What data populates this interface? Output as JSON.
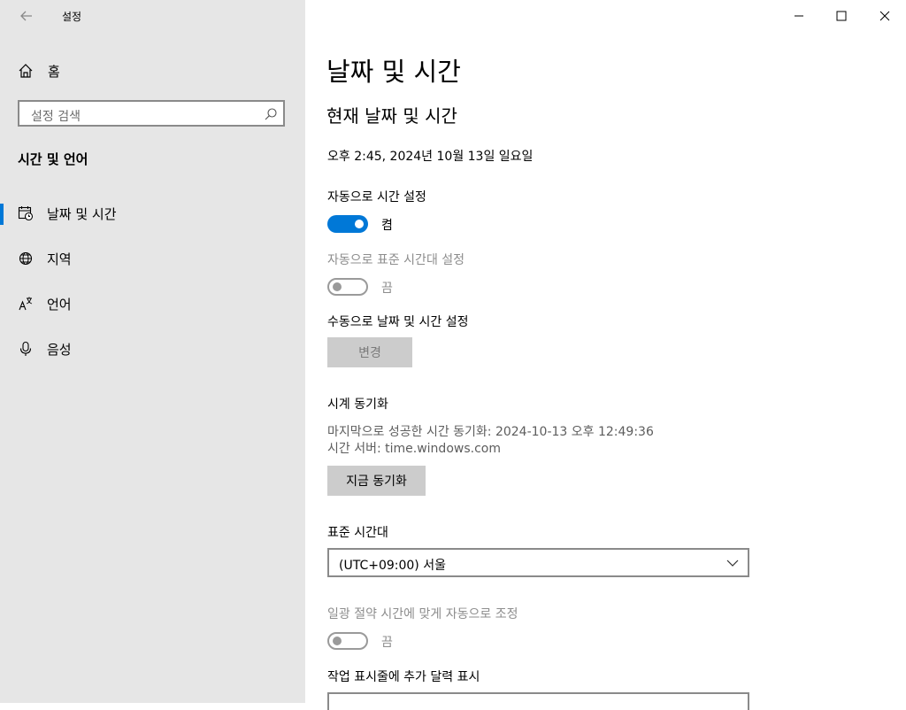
{
  "window": {
    "app_title": "설정",
    "controls": [
      "minimize-icon",
      "maximize-icon",
      "close-icon"
    ]
  },
  "sidebar": {
    "home_label": "홈",
    "search_placeholder": "설정 검색",
    "section_title": "시간 및 언어",
    "items": [
      {
        "label": "날짜 및 시간",
        "icon": "calendar-clock-icon",
        "selected": true
      },
      {
        "label": "지역",
        "icon": "globe-icon",
        "selected": false
      },
      {
        "label": "언어",
        "icon": "language-icon",
        "selected": false
      },
      {
        "label": "음성",
        "icon": "microphone-icon",
        "selected": false
      }
    ]
  },
  "main": {
    "page_title": "날짜 및 시간",
    "current_heading": "현재 날짜 및 시간",
    "current_datetime": "오후 2:45, 2024년 10월 13일 일요일",
    "auto_time": {
      "label": "자동으로 시간 설정",
      "state": "켬",
      "on": true
    },
    "auto_timezone": {
      "label": "자동으로 표준 시간대 설정",
      "state": "끔",
      "on": false,
      "disabled": true
    },
    "manual": {
      "label": "수동으로 날짜 및 시간 설정",
      "button": "변경"
    },
    "sync": {
      "heading": "시계 동기화",
      "last_sync": "마지막으로 성공한 시간 동기화: 2024-10-13 오후 12:49:36",
      "server": "시간 서버: time.windows.com",
      "button": "지금 동기화"
    },
    "timezone": {
      "label": "표준 시간대",
      "value": "(UTC+09:00) 서울"
    },
    "dst": {
      "label": "일광 절약 시간에 맞게 자동으로 조정",
      "state": "끔",
      "on": false,
      "disabled": true
    },
    "extra_calendar": {
      "label": "작업 표시줄에 추가 달력 표시"
    }
  },
  "colors": {
    "accent": "#0078d7",
    "sidebar_bg": "#e6e6e6",
    "button_bg": "#cccccc"
  }
}
